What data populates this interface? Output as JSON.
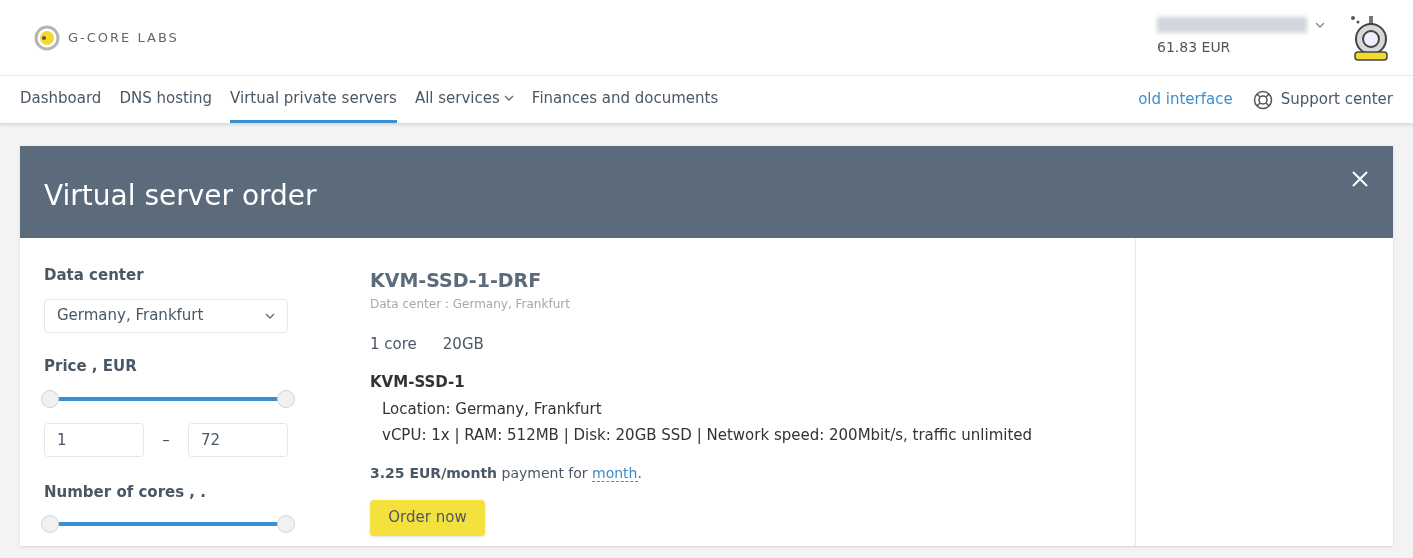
{
  "header": {
    "logo_text": "G-CORE LABS",
    "balance": "61.83 EUR"
  },
  "nav": {
    "items": [
      {
        "label": "Dashboard",
        "selected": false,
        "dropdown": false
      },
      {
        "label": "DNS hosting",
        "selected": false,
        "dropdown": false
      },
      {
        "label": "Virtual private servers",
        "selected": true,
        "dropdown": false
      },
      {
        "label": "All services",
        "selected": false,
        "dropdown": true
      },
      {
        "label": "Finances and documents",
        "selected": false,
        "dropdown": false
      }
    ],
    "old_interface_link": "old interface",
    "support_link": "Support center"
  },
  "dialog": {
    "title": "Virtual server order",
    "filters": {
      "data_center": {
        "label": "Data center",
        "value": "Germany, Frankfurt"
      },
      "price": {
        "label": "Price , EUR",
        "level": 1,
        "min": "1",
        "separator": "–",
        "max": "72"
      },
      "cores": {
        "label": "Number of cores , .",
        "level": 1
      }
    },
    "offer": {
      "name": "KVM-SSD-1-DRF",
      "data_center": "Data center : Germany, Frankfurt",
      "cores": "1 core",
      "disk": "20GB",
      "plan": "KVM-SSD-1",
      "location": "Location: Germany, Frankfurt",
      "specs": "vCPU: 1x | RAM: 512MB | Disk: 20GB SSD | Network speed: 200Mbit/s, traffic unlimited",
      "payment_text": "**3.25 EUR/month** payment for",
      "payment_link": "month",
      "payment_end": ".",
      "order_button": "Order now"
    }
  }
}
